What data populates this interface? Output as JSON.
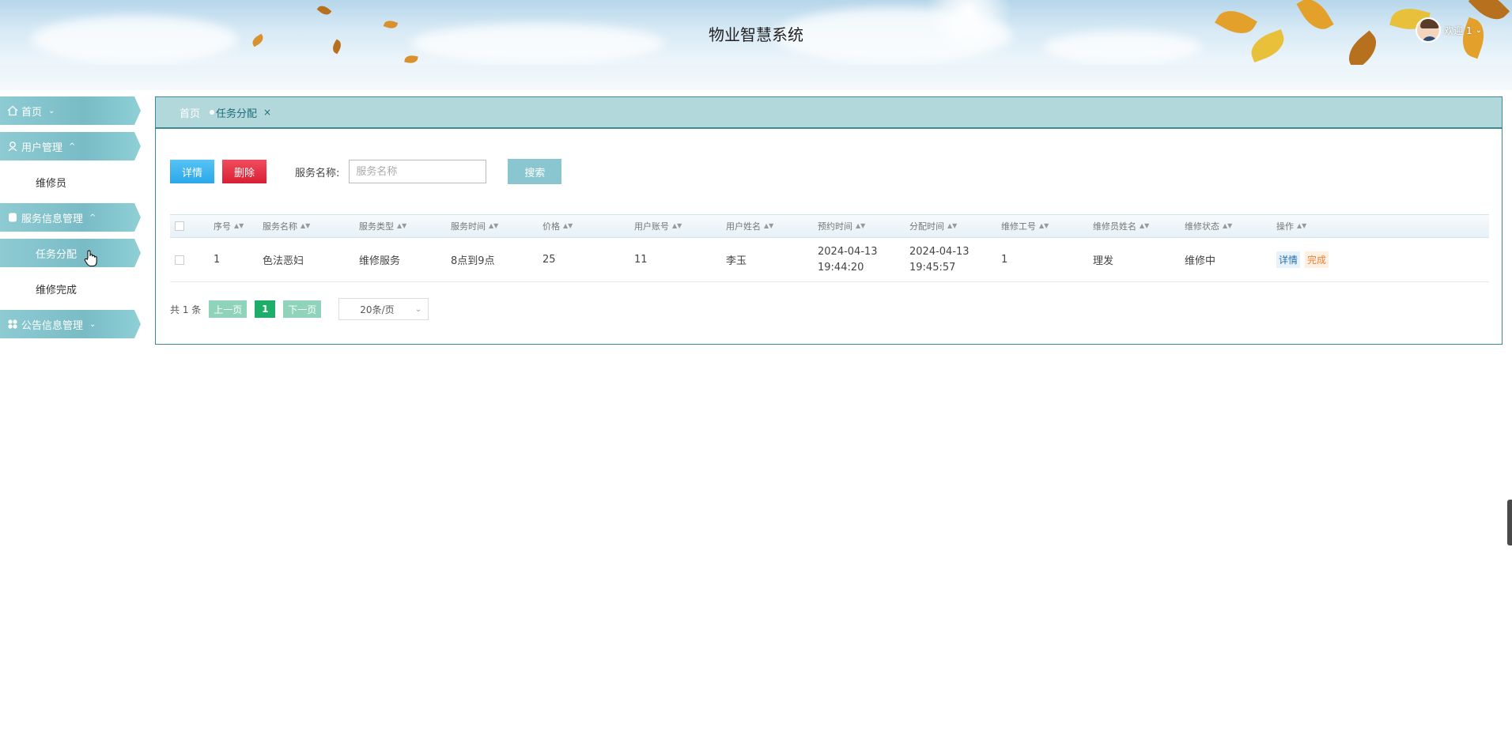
{
  "header": {
    "title": "物业智慧系统",
    "user_label": "欢迎 1",
    "user_caret": "⌄"
  },
  "sidebar": {
    "groups": [
      {
        "label": "首页",
        "caret": "⌄",
        "icon": "home-icon"
      },
      {
        "label": "用户管理",
        "caret": "^",
        "icon": "user-icon",
        "children": [
          "维修员"
        ]
      },
      {
        "label": "服务信息管理",
        "caret": "^",
        "icon": "service-icon",
        "children": [
          "任务分配",
          "维修完成"
        ],
        "active_child": "任务分配"
      },
      {
        "label": "公告信息管理",
        "caret": "⌄",
        "icon": "grid-icon"
      }
    ]
  },
  "tabs": {
    "home": "首页",
    "active": "任务分配",
    "close": "×"
  },
  "toolbar": {
    "detail_label": "详情",
    "delete_label": "删除",
    "search_label": "服务名称:",
    "search_placeholder": "服务名称",
    "search_value": "",
    "search_button": "搜索"
  },
  "table": {
    "columns": [
      "序号",
      "服务名称",
      "服务类型",
      "服务时间",
      "价格",
      "用户账号",
      "用户姓名",
      "预约时间",
      "分配时间",
      "维修工号",
      "维修员姓名",
      "维修状态",
      "操作"
    ],
    "rows": [
      {
        "cells": [
          "1",
          "色法恶妇",
          "维修服务",
          "8点到9点",
          "25",
          "11",
          "李玉",
          "2024-04-13 19:44:20",
          "2024-04-13 19:45:57",
          "1",
          "理发",
          "维修中"
        ],
        "actions": [
          "详情",
          "完成"
        ]
      }
    ]
  },
  "pager": {
    "total": "共 1 条",
    "prev": "上一页",
    "current": "1",
    "next": "下一页",
    "page_size": "20条/页"
  },
  "colors": {
    "accent": "#3d8a94",
    "tab_bar": "#b3d8dc",
    "menu": "#79bcc6",
    "detail_button": "#2aa8e8",
    "delete_button": "#d91e33",
    "search_button": "#8ac6cf",
    "page_active": "#1fae6a"
  }
}
